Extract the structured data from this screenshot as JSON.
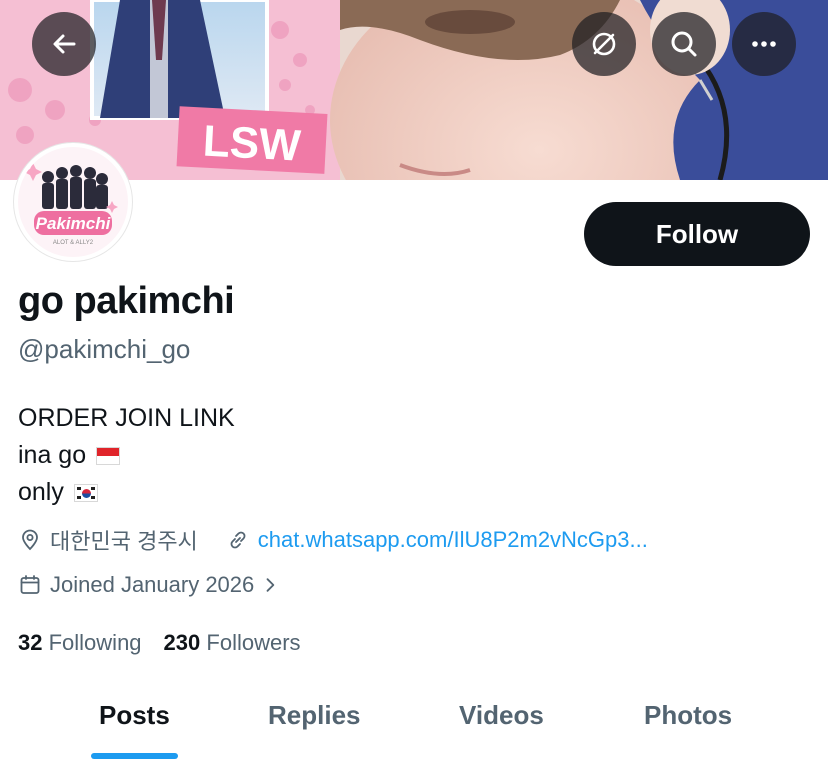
{
  "banner": {
    "sticker_text": "LSW"
  },
  "avatar": {
    "logo_text": "Pakimchi",
    "logo_subtext": "ALOT & ALLY2"
  },
  "actions": {
    "follow_label": "Follow"
  },
  "profile": {
    "display_name": "go pakimchi",
    "handle": "@pakimchi_go",
    "bio": [
      "ORDER JOIN LINK",
      "ina go",
      "only"
    ],
    "location": "대한민국 경주시",
    "website": "chat.whatsapp.com/IlU8P2m2vNcGp3...",
    "joined": "Joined January 2026"
  },
  "stats": {
    "following_count": "32",
    "following_label": "Following",
    "followers_count": "230",
    "followers_label": "Followers"
  },
  "tabs": [
    {
      "label": "Posts"
    },
    {
      "label": "Replies"
    },
    {
      "label": "Videos"
    },
    {
      "label": "Photos"
    }
  ],
  "colors": {
    "accent": "#1d9bf0",
    "text": "#0f1419",
    "secondary": "#536471"
  }
}
